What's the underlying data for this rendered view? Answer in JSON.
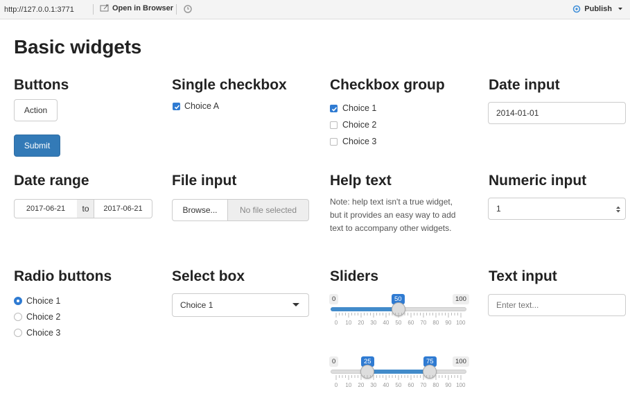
{
  "topbar": {
    "url": "http://127.0.0.1:3771",
    "open_label": "Open in Browser",
    "publish_label": "Publish"
  },
  "page": {
    "title": "Basic widgets"
  },
  "buttons": {
    "heading": "Buttons",
    "action_label": "Action",
    "submit_label": "Submit"
  },
  "single_checkbox": {
    "heading": "Single checkbox",
    "label": "Choice A",
    "checked": true
  },
  "checkbox_group": {
    "heading": "Checkbox group",
    "items": [
      {
        "label": "Choice 1",
        "checked": true
      },
      {
        "label": "Choice 2",
        "checked": false
      },
      {
        "label": "Choice 3",
        "checked": false
      }
    ]
  },
  "date_input": {
    "heading": "Date input",
    "value": "2014-01-01"
  },
  "date_range": {
    "heading": "Date range",
    "start": "2017-06-21",
    "separator": "to",
    "end": "2017-06-21"
  },
  "file_input": {
    "heading": "File input",
    "browse_label": "Browse...",
    "status": "No file selected"
  },
  "help_text": {
    "heading": "Help text",
    "text": "Note: help text isn't a true widget, but it provides an easy way to add text to accompany other widgets."
  },
  "numeric_input": {
    "heading": "Numeric input",
    "value": "1"
  },
  "radio_buttons": {
    "heading": "Radio buttons",
    "items": [
      {
        "label": "Choice 1",
        "selected": true
      },
      {
        "label": "Choice 2",
        "selected": false
      },
      {
        "label": "Choice 3",
        "selected": false
      }
    ]
  },
  "select_box": {
    "heading": "Select box",
    "value": "Choice 1"
  },
  "sliders": {
    "heading": "Sliders",
    "slider1": {
      "min": "0",
      "max": "100",
      "value": "50"
    },
    "slider2": {
      "min": "0",
      "max": "100",
      "low": "25",
      "high": "75"
    },
    "tick_labels": [
      "0",
      "10",
      "20",
      "30",
      "40",
      "50",
      "60",
      "70",
      "80",
      "90",
      "100"
    ]
  },
  "text_input": {
    "heading": "Text input",
    "placeholder": "Enter text..."
  },
  "colors": {
    "primary": "#337ab7",
    "checked": "#2f7bd2"
  }
}
